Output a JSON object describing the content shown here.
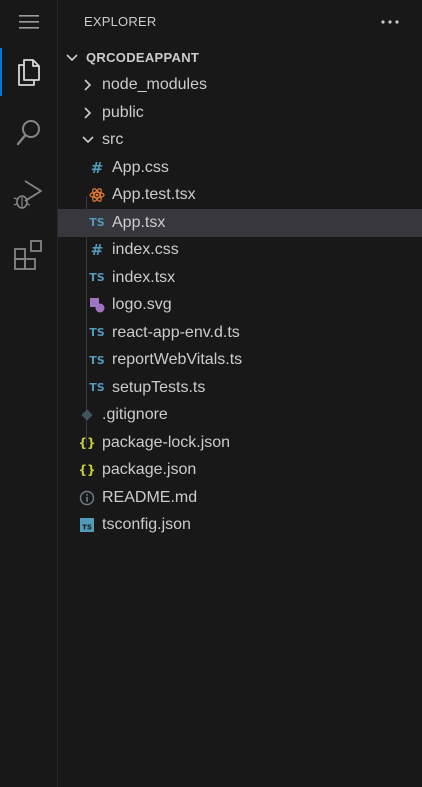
{
  "activity_bar": {
    "items": [
      {
        "name": "explorer",
        "icon": "files-icon",
        "active": true
      },
      {
        "name": "search",
        "icon": "search-icon",
        "active": false
      },
      {
        "name": "run-debug",
        "icon": "run-debug-icon",
        "active": false
      },
      {
        "name": "extensions",
        "icon": "extensions-icon",
        "active": false
      }
    ]
  },
  "sidebar": {
    "title": "EXPLORER",
    "root": "QRCODEAPPANT",
    "items": [
      {
        "label": "node_modules",
        "kind": "folder",
        "expanded": false
      },
      {
        "label": "public",
        "kind": "folder",
        "expanded": false
      },
      {
        "label": "src",
        "kind": "folder",
        "expanded": true
      },
      {
        "label": "App.css",
        "kind": "css",
        "icon": "#"
      },
      {
        "label": "App.test.tsx",
        "kind": "react",
        "icon": "react-icon"
      },
      {
        "label": "App.tsx",
        "kind": "ts",
        "icon": "TS",
        "selected": true
      },
      {
        "label": "index.css",
        "kind": "css",
        "icon": "#"
      },
      {
        "label": "index.tsx",
        "kind": "ts",
        "icon": "TS"
      },
      {
        "label": "logo.svg",
        "kind": "svg",
        "icon": "svg-icon"
      },
      {
        "label": "react-app-env.d.ts",
        "kind": "ts",
        "icon": "TS"
      },
      {
        "label": "reportWebVitals.ts",
        "kind": "ts",
        "icon": "TS"
      },
      {
        "label": "setupTests.ts",
        "kind": "ts",
        "icon": "TS"
      },
      {
        "label": ".gitignore",
        "kind": "git",
        "icon": "git-icon"
      },
      {
        "label": "package-lock.json",
        "kind": "json",
        "icon": "{}"
      },
      {
        "label": "package.json",
        "kind": "json",
        "icon": "{}"
      },
      {
        "label": "README.md",
        "kind": "info",
        "icon": "info-icon"
      },
      {
        "label": "tsconfig.json",
        "kind": "tsconfig",
        "icon": "TS"
      }
    ]
  },
  "colors": {
    "accent": "#0078d4",
    "ts": "#519aba",
    "css": "#519aba",
    "react": "#e37933",
    "json": "#cbcb41",
    "svg": "#a074c4",
    "git": "#41535b",
    "info": "#6d8086"
  }
}
